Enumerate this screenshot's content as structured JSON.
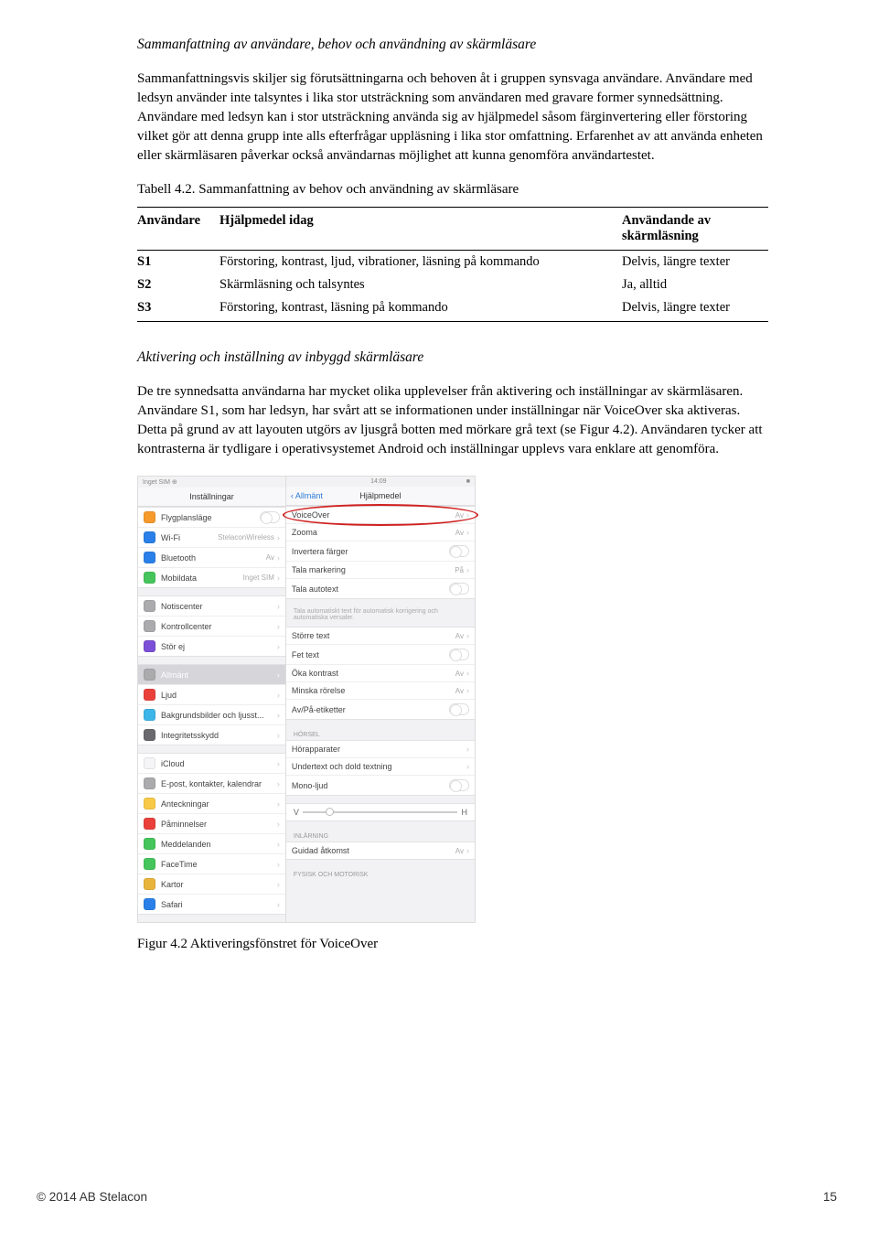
{
  "h1": "Sammanfattning av användare, behov och användning av skärmläsare",
  "p1": "Sammanfattningsvis skiljer sig förutsättningarna och behoven åt i gruppen synsvaga användare. Användare med ledsyn använder inte talsyntes i lika stor utsträckning som användaren med gravare former synnedsättning. Användare med ledsyn kan i stor utsträckning använda sig av hjälpmedel såsom färginvertering eller förstoring vilket gör att denna grupp inte alls efterfrågar uppläsning i lika stor omfattning. Erfarenhet av att använda enheten eller skärmläsaren påverkar också användarnas möjlighet att kunna genomföra användartestet.",
  "tabcaption": "Tabell 4.2. Sammanfattning av behov och användning av skärmläsare",
  "th1": "Användare",
  "th2": "Hjälpmedel idag",
  "th3": "Användande av skärmläsning",
  "rows": [
    {
      "u": "S1",
      "h": "Förstoring, kontrast, ljud, vibrationer, läsning på kommando",
      "a": "Delvis, längre texter"
    },
    {
      "u": "S2",
      "h": "Skärmläsning och talsyntes",
      "a": "Ja, alltid"
    },
    {
      "u": "S3",
      "h": "Förstoring, kontrast, läsning på kommando",
      "a": "Delvis, längre texter"
    }
  ],
  "h2": "Aktivering och inställning av inbyggd skärmläsare",
  "p2": "De tre synnedsatta användarna har mycket olika upplevelser från aktivering och inställningar av skärmläsaren. Användare S1, som har ledsyn, har svårt att se informationen under inställningar när VoiceOver ska aktiveras. Detta på grund av att layouten utgörs av ljusgrå botten med mörkare grå text (se Figur 4.2). Användaren tycker att kontrasterna är tydligare i operativsystemet Android och inställningar upplevs vara enklare att genomföra.",
  "figcaption": "Figur 4.2 Aktiveringsfönstret för VoiceOver",
  "footerLeft": "© 2014 AB Stelacon",
  "footerRight": "15",
  "fig": {
    "status": {
      "left": "Inget SIM ⊕",
      "mid": "14:09",
      "right": "■"
    },
    "leftTitle": "Inställningar",
    "rightBack": "Allmänt",
    "rightTitle": "Hjälpmedel",
    "leftItems": [
      {
        "icon": "#f79a2c",
        "label": "Flygplansläge",
        "type": "toggle"
      },
      {
        "icon": "#2a80e8",
        "label": "Wi-Fi",
        "val": "StelaconWireless"
      },
      {
        "icon": "#2a80e8",
        "label": "Bluetooth",
        "val": "Av"
      },
      {
        "icon": "#45c55b",
        "label": "Mobildata",
        "val": "Inget SIM"
      }
    ],
    "leftItems2": [
      {
        "icon": "#ababae",
        "label": "Notiscenter"
      },
      {
        "icon": "#ababae",
        "label": "Kontrollcenter"
      },
      {
        "icon": "#7b4fd6",
        "label": "Stör ej"
      }
    ],
    "leftItems3": [
      {
        "icon": "#ababae",
        "label": "Allmänt",
        "active": true
      },
      {
        "icon": "#e9413a",
        "label": "Ljud"
      },
      {
        "icon": "#3cb5e8",
        "label": "Bakgrundsbilder och ljusst..."
      },
      {
        "icon": "#6a6a6e",
        "label": "Integritetsskydd"
      }
    ],
    "leftItems4": [
      {
        "icon": "#f5f5f7",
        "label": "iCloud"
      },
      {
        "icon": "#ababae",
        "label": "E-post, kontakter, kalendrar"
      },
      {
        "icon": "#f7c946",
        "label": "Anteckningar"
      },
      {
        "icon": "#e9413a",
        "label": "Påminnelser"
      },
      {
        "icon": "#45c55b",
        "label": "Meddelanden"
      },
      {
        "icon": "#45c55b",
        "label": "FaceTime"
      },
      {
        "icon": "#e9b43a",
        "label": "Kartor"
      },
      {
        "icon": "#2a80e8",
        "label": "Safari"
      }
    ],
    "rightGroup1": [
      {
        "label": "VoiceOver",
        "val": "Av",
        "highlight": true
      },
      {
        "label": "Zooma",
        "val": "Av"
      },
      {
        "label": "Invertera färger",
        "type": "toggle"
      },
      {
        "label": "Tala markering",
        "val": "På"
      },
      {
        "label": "Tala autotext",
        "type": "toggle"
      }
    ],
    "rightSub": "Tala automatiskt text för automatisk korrigering och automatiska versaler.",
    "rightGroup2": [
      {
        "label": "Större text",
        "val": "Av"
      },
      {
        "label": "Fet text",
        "type": "toggle"
      },
      {
        "label": "Öka kontrast",
        "val": "Av"
      },
      {
        "label": "Minska rörelse",
        "val": "Av"
      },
      {
        "label": "Av/På-etiketter",
        "type": "toggle"
      }
    ],
    "hdrHorsel": "HÖRSEL",
    "rightGroup3": [
      {
        "label": "Hörapparater"
      },
      {
        "label": "Undertext och dold textning"
      },
      {
        "label": "Mono-ljud",
        "type": "toggle"
      }
    ],
    "sliderL": "V",
    "sliderR": "H",
    "hdrInlarning": "INLÄRNING",
    "rightGroup4": [
      {
        "label": "Guidad åtkomst",
        "val": "Av"
      }
    ],
    "hdrFysisk": "FYSISK OCH MOTORISK"
  }
}
